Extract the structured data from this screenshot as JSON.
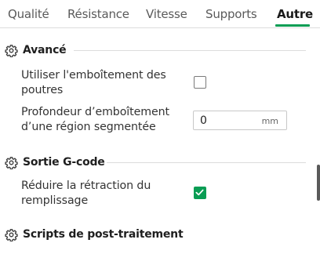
{
  "tabs": [
    {
      "label": "Qualité"
    },
    {
      "label": "Résistance"
    },
    {
      "label": "Vitesse"
    },
    {
      "label": "Supports"
    },
    {
      "label": "Autre",
      "active": true
    }
  ],
  "sections": {
    "advanced": {
      "title": "Avancé",
      "icon": "gear-icon",
      "options": {
        "beam_interlocking": {
          "label_line1": "Utiliser l'emboîtement des",
          "label_line2": "poutres",
          "checked": false
        },
        "interlocking_depth": {
          "label_line1": "Profondeur d’emboîtement",
          "label_line2": "d’une région segmentée",
          "value": "0",
          "unit": "mm"
        }
      }
    },
    "gcode_output": {
      "title": "Sortie G-code",
      "icon": "gear-icon",
      "options": {
        "reduce_infill_retraction": {
          "label_line1": "Réduire la rétraction du",
          "label_line2": "remplissage",
          "checked": true
        }
      }
    },
    "post_processing": {
      "title": "Scripts de post-traitement",
      "icon": "gear-icon"
    }
  },
  "colors": {
    "accent": "#0a9d54",
    "divider": "#dcdcdc"
  }
}
